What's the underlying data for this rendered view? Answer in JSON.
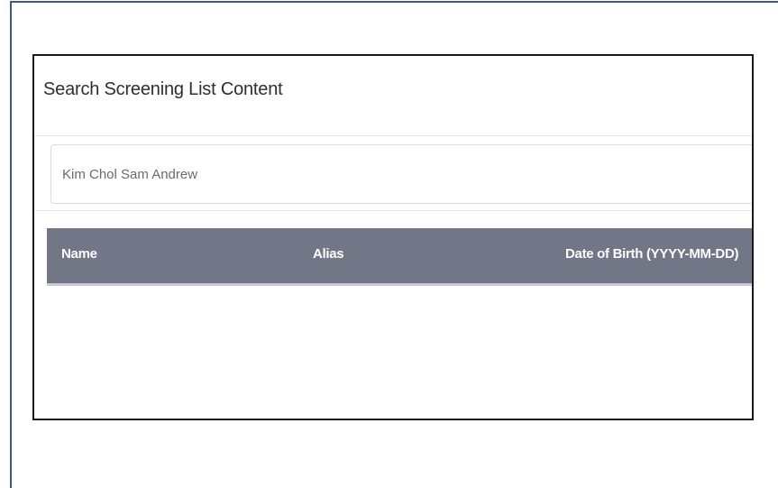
{
  "panel": {
    "title": "Search Screening List Content"
  },
  "search": {
    "value": "Kim Chol Sam Andrew",
    "placeholder": ""
  },
  "table": {
    "columns": [
      "Name",
      "Alias",
      "Date of Birth (YYYY-MM-DD)"
    ],
    "rows": []
  },
  "colors": {
    "header_bg": "#717787",
    "frame_border": "#3b5a8c"
  }
}
